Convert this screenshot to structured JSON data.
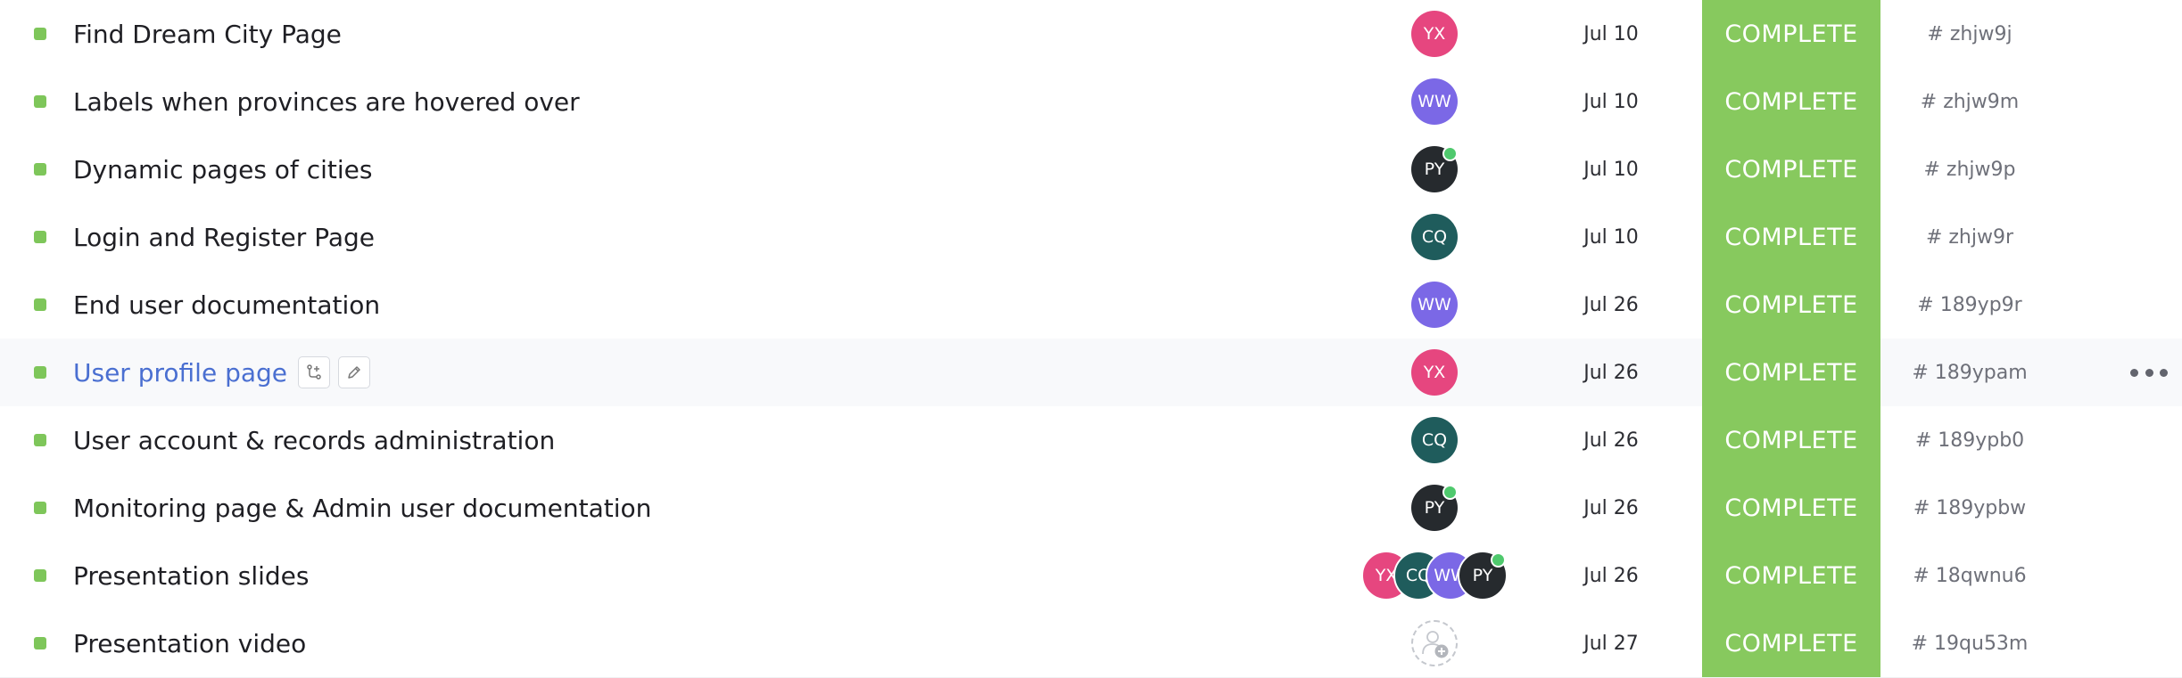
{
  "colors": {
    "status_complete": "#87c95e",
    "status_dot": "#7ec65a",
    "online": "#4fc96d"
  },
  "avatars": {
    "YX": "#e6467f",
    "WW": "#7b68e6",
    "PY": "#262a2e",
    "CQ": "#1f5c5c"
  },
  "tasks": [
    {
      "name": "Find Dream City Page",
      "assignees": [
        {
          "initials": "YX",
          "online": false
        }
      ],
      "due": "Jul 10",
      "status": "COMPLETE",
      "id": "# zhjw9j"
    },
    {
      "name": "Labels when provinces are hovered over",
      "assignees": [
        {
          "initials": "WW",
          "online": false
        }
      ],
      "due": "Jul 10",
      "status": "COMPLETE",
      "id": "# zhjw9m"
    },
    {
      "name": "Dynamic pages of cities",
      "assignees": [
        {
          "initials": "PY",
          "online": true
        }
      ],
      "due": "Jul 10",
      "status": "COMPLETE",
      "id": "# zhjw9p"
    },
    {
      "name": "Login and Register Page",
      "assignees": [
        {
          "initials": "CQ",
          "online": false
        }
      ],
      "due": "Jul 10",
      "status": "COMPLETE",
      "id": "# zhjw9r"
    },
    {
      "name": "End user documentation",
      "assignees": [
        {
          "initials": "WW",
          "online": false
        }
      ],
      "due": "Jul 26",
      "status": "COMPLETE",
      "id": "# 189yp9r"
    },
    {
      "name": "User profile page",
      "hovered": true,
      "actions": [
        "subtask-icon",
        "pencil-icon"
      ],
      "more": "more-options-icon",
      "assignees": [
        {
          "initials": "YX",
          "online": false
        }
      ],
      "due": "Jul 26",
      "status": "COMPLETE",
      "id": "# 189ypam"
    },
    {
      "name": "User account & records administration",
      "assignees": [
        {
          "initials": "CQ",
          "online": false
        }
      ],
      "due": "Jul 26",
      "status": "COMPLETE",
      "id": "# 189ypb0"
    },
    {
      "name": "Monitoring page & Admin user documentation",
      "assignees": [
        {
          "initials": "PY",
          "online": true
        }
      ],
      "due": "Jul 26",
      "status": "COMPLETE",
      "id": "# 189ypbw"
    },
    {
      "name": "Presentation slides",
      "assignees": [
        {
          "initials": "YX",
          "online": false
        },
        {
          "initials": "CQ",
          "online": false
        },
        {
          "initials": "WW",
          "online": false
        },
        {
          "initials": "PY",
          "online": true
        }
      ],
      "due": "Jul 26",
      "status": "COMPLETE",
      "id": "# 18qwnu6"
    },
    {
      "name": "Presentation video",
      "assignees": [],
      "assignee_icon": "add-assignee-icon",
      "due": "Jul 27",
      "status": "COMPLETE",
      "id": "# 19qu53m"
    }
  ]
}
